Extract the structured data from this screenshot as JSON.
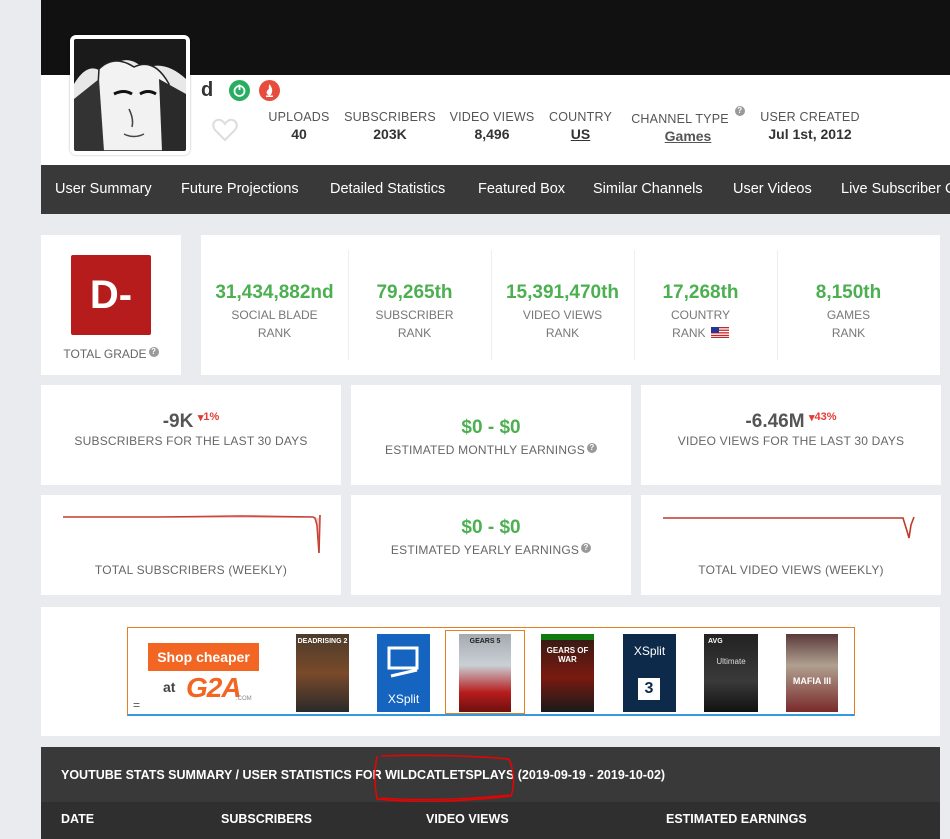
{
  "channel": {
    "name": "d",
    "badges": [
      {
        "icon": "power-icon",
        "color": "#27ae60"
      },
      {
        "icon": "flame-icon",
        "color": "#e74c3c"
      }
    ]
  },
  "stats": [
    {
      "label": "UPLOADS",
      "value": "40"
    },
    {
      "label": "SUBSCRIBERS",
      "value": "203K"
    },
    {
      "label": "VIDEO VIEWS",
      "value": "8,496"
    },
    {
      "label": "COUNTRY",
      "value": "US"
    },
    {
      "label": "CHANNEL TYPE",
      "value": "Games"
    },
    {
      "label": "USER CREATED",
      "value": "Jul 1st, 2012"
    }
  ],
  "nav": [
    "User Summary",
    "Future Projections",
    "Detailed Statistics",
    "Featured Box",
    "Similar Channels",
    "User Videos",
    "Live Subscriber C"
  ],
  "grade": {
    "value": "D-",
    "label": "TOTAL GRADE",
    "color": "#b71c1c"
  },
  "ranks": [
    {
      "value": "31,434,882nd",
      "line1": "SOCIAL BLADE",
      "line2": "RANK"
    },
    {
      "value": "79,265th",
      "line1": "SUBSCRIBER",
      "line2": "RANK"
    },
    {
      "value": "15,391,470th",
      "line1": "VIDEO VIEWS",
      "line2": "RANK"
    },
    {
      "value": "17,268th",
      "line1": "COUNTRY",
      "line2": "RANK"
    },
    {
      "value": "8,150th",
      "line1": "GAMES",
      "line2": "RANK"
    }
  ],
  "monthly": {
    "subs": {
      "value": "-9K",
      "change": "1%",
      "label": "SUBSCRIBERS FOR THE LAST 30 DAYS"
    },
    "earnings": {
      "value": "$0 - $0",
      "label": "ESTIMATED MONTHLY EARNINGS"
    },
    "views": {
      "value": "-6.46M",
      "change": "43%",
      "label": "VIDEO VIEWS FOR THE LAST 30 DAYS"
    }
  },
  "weekly": {
    "subs_label": "TOTAL SUBSCRIBERS (WEEKLY)",
    "yearly": {
      "value": "$0 - $0",
      "label": "ESTIMATED YEARLY EARNINGS"
    },
    "views_label": "TOTAL VIDEO VIEWS (WEEKLY)"
  },
  "ad": {
    "shop_text": "Shop cheaper",
    "at_text": "at",
    "brand": "G2A",
    "brand_suffix": ".COM",
    "corner": "=",
    "tiles": [
      {
        "title": "DEADRISING 2",
        "icon": "dead-rising-2-cover"
      },
      {
        "title": "XSplit",
        "icon": "xsplit-cover"
      },
      {
        "title": "GEARS 5",
        "icon": "gears-5-cover"
      },
      {
        "title": "GEARS OF WAR",
        "icon": "gears-of-war-cover"
      },
      {
        "title": "XSplit",
        "sub": "3",
        "icon": "xsplit-3-cover"
      },
      {
        "title": "AVG",
        "sub": "Ultimate",
        "icon": "avg-ultimate-cover"
      },
      {
        "title": "MAFIA III",
        "icon": "mafia-3-cover"
      }
    ]
  },
  "summary": {
    "prefix": "YOUTUBE STATS SUMMARY / USER STATISTICS FOR",
    "channel": "WILDCATLETSPLAYS",
    "range": "(2019-09-19 - 2019-10-02)"
  },
  "table_headers": [
    "DATE",
    "SUBSCRIBERS",
    "VIDEO VIEWS",
    "ESTIMATED EARNINGS"
  ]
}
